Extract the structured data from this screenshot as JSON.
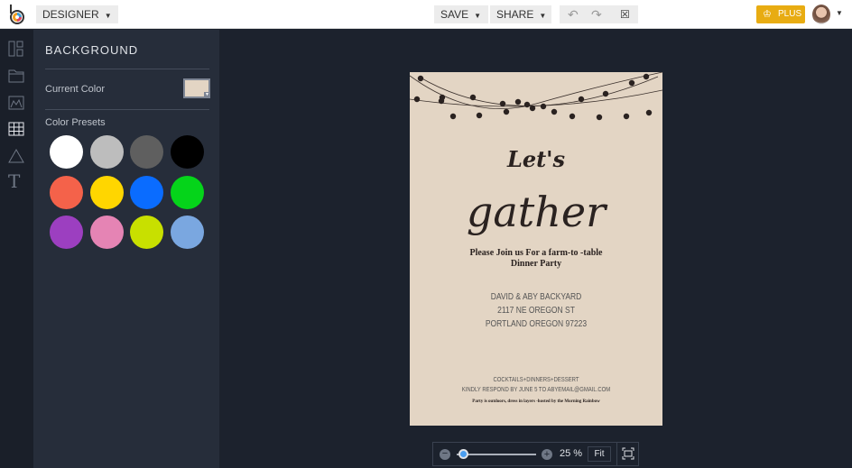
{
  "header": {
    "mode": "DESIGNER",
    "save": "SAVE",
    "share": "SHARE",
    "plus": "PLUS"
  },
  "sidebar": {
    "title": "BACKGROUND",
    "current_color_label": "Current Color",
    "current_color": "#e3d5c4",
    "presets_label": "Color Presets",
    "presets": [
      "#ffffff",
      "#bdbdbd",
      "#5f5f5f",
      "#000000",
      "#f4624a",
      "#ffd600",
      "#0a6cff",
      "#05d41a",
      "#9c3fc0",
      "#e584b4",
      "#c8e000",
      "#7aa7e0"
    ]
  },
  "design": {
    "line1": "Let's",
    "line2": "gather",
    "invite1": "Please Join us For a farm-to -table",
    "invite2": "Dinner Party",
    "addr1": "DAVID & ABY BACKYARD",
    "addr2": "2117 NE OREGON ST",
    "addr3": "PORTLAND OREGON 97223",
    "menu": "COCKTAILS+DINNERS+DESSERT",
    "rsvp": "KINDLY RESPOND BY JUNE 5 TO ABYEMAIL@GMAIL.COM",
    "note": "Party is outdoors, dress in layers -hosted by the Morning Rainbow"
  },
  "zoom": {
    "level": "25 %",
    "fit": "Fit",
    "value": 0.08
  }
}
